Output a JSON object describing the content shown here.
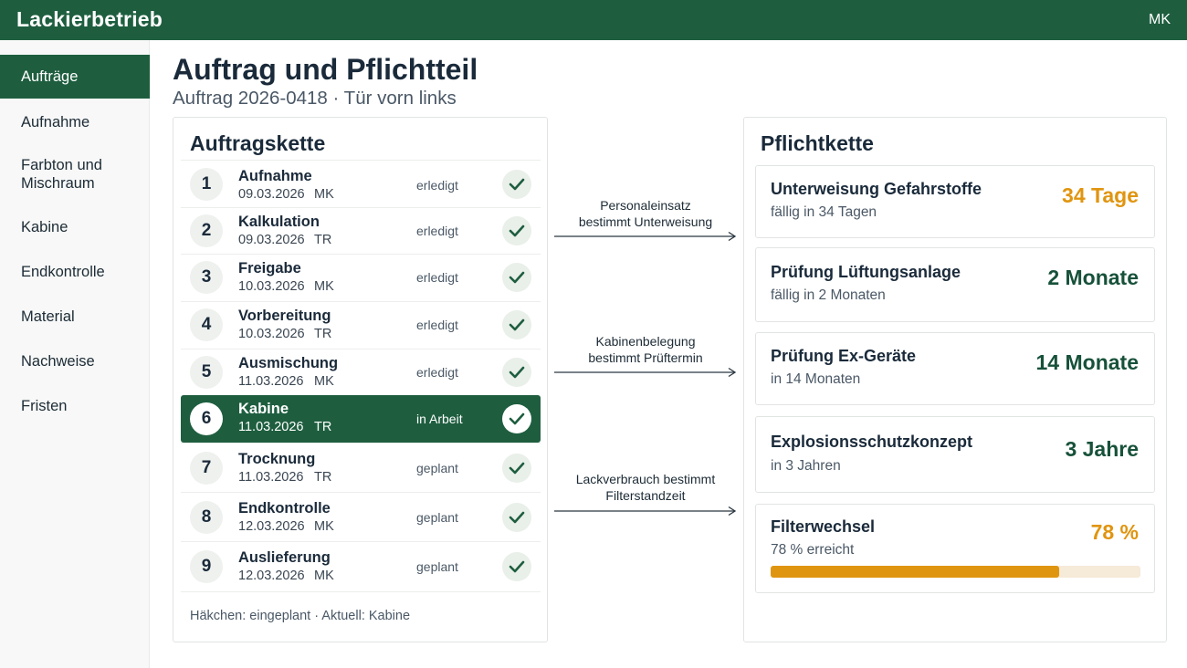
{
  "app": {
    "title": "Lackierbetrieb",
    "user": "MK"
  },
  "colors": {
    "brand": "#1e5e3f",
    "warning": "#e09510",
    "ok": "#1e5e3f"
  },
  "sidebar": {
    "items": [
      {
        "label": "Aufträge",
        "active": true
      },
      {
        "label": "Aufnahme"
      },
      {
        "label": "Farbton und Mischraum"
      },
      {
        "label": "Kabine"
      },
      {
        "label": "Endkontrolle"
      },
      {
        "label": "Material"
      },
      {
        "label": "Nachweise"
      },
      {
        "label": "Fristen"
      }
    ]
  },
  "page": {
    "title": "Auftrag und Pflichtteil",
    "subtitle": "Auftrag 2026-0418 · Tür vorn links"
  },
  "chain": {
    "title": "Auftragskette",
    "steps": [
      {
        "num": "1",
        "name": "Aufnahme",
        "date": "09.03.2026",
        "who": "MK",
        "status": "erledigt"
      },
      {
        "num": "2",
        "name": "Kalkulation",
        "date": "09.03.2026",
        "who": "TR",
        "status": "erledigt"
      },
      {
        "num": "3",
        "name": "Freigabe",
        "date": "10.03.2026",
        "who": "MK",
        "status": "erledigt"
      },
      {
        "num": "4",
        "name": "Vorbereitung",
        "date": "10.03.2026",
        "who": "TR",
        "status": "erledigt"
      },
      {
        "num": "5",
        "name": "Ausmischung",
        "date": "11.03.2026",
        "who": "MK",
        "status": "erledigt"
      },
      {
        "num": "6",
        "name": "Kabine",
        "date": "11.03.2026",
        "who": "TR",
        "status": "in Arbeit",
        "current": true
      },
      {
        "num": "7",
        "name": "Trocknung",
        "date": "11.03.2026",
        "who": "TR",
        "status": "geplant"
      },
      {
        "num": "8",
        "name": "Endkontrolle",
        "date": "12.03.2026",
        "who": "MK",
        "status": "geplant"
      },
      {
        "num": "9",
        "name": "Auslieferung",
        "date": "12.03.2026",
        "who": "MK",
        "status": "geplant"
      }
    ],
    "legend": "Häkchen: eingeplant · Aktuell: Kabine"
  },
  "connectors": [
    {
      "line1": "Personaleinsatz",
      "line2": "bestimmt Unterweisung"
    },
    {
      "line1": "Kabinenbelegung",
      "line2": "bestimmt Prüftermin"
    },
    {
      "line1": "Lackverbrauch bestimmt",
      "line2": "Filterstandzeit"
    }
  ],
  "duties": {
    "title": "Pflichtkette",
    "items": [
      {
        "title": "Unterweisung Gefahrstoffe",
        "sub": "fällig in 34 Tagen",
        "value": "34 Tage",
        "tone": "warning"
      },
      {
        "title": "Prüfung Lüftungsanlage",
        "sub": "fällig in 2 Monaten",
        "value": "2 Monate",
        "tone": "ok"
      },
      {
        "title": "Prüfung Ex-Geräte",
        "sub": "in 14 Monaten",
        "value": "14 Monate",
        "tone": "ok"
      },
      {
        "title": "Explosionsschutzkonzept",
        "sub": "in 3 Jahren",
        "value": "3 Jahre",
        "tone": "ok"
      },
      {
        "title": "Filterwechsel",
        "sub": "78 % erreicht",
        "value": "78 %",
        "tone": "warning",
        "progress": 0.78
      }
    ]
  }
}
